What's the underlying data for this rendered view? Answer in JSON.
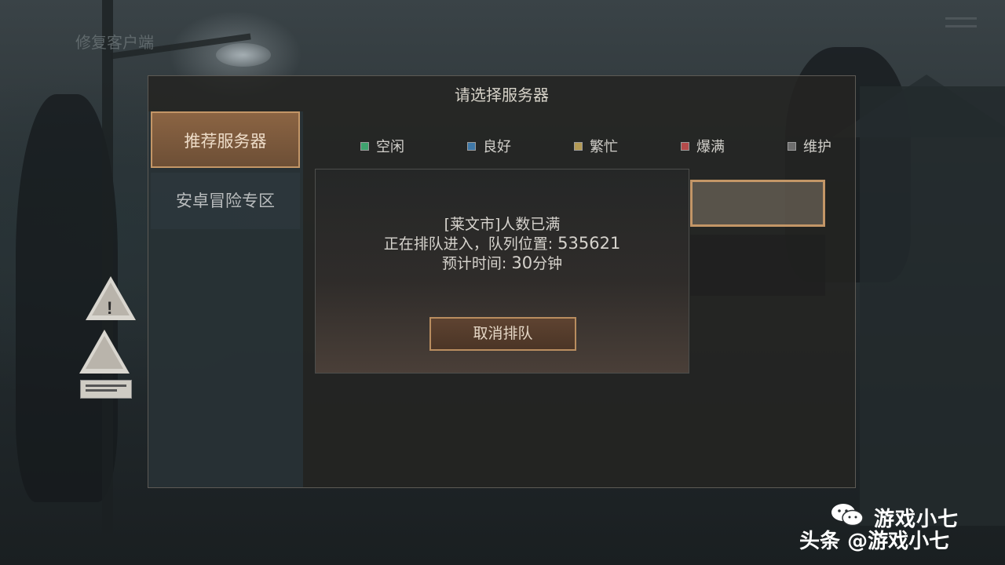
{
  "app": {
    "title": "修复客户端"
  },
  "dialog": {
    "title": "请选择服务器",
    "sidebar": [
      {
        "label": "推荐服务器",
        "active": true
      },
      {
        "label": "安卓冒险专区",
        "active": false
      }
    ],
    "legend": [
      {
        "label": "空闲",
        "color": "#3fa36f"
      },
      {
        "label": "良好",
        "color": "#3f78a8"
      },
      {
        "label": "繁忙",
        "color": "#b39a55"
      },
      {
        "label": "爆满",
        "color": "#b54b4b"
      },
      {
        "label": "维护",
        "color": "#6e6e6e"
      }
    ]
  },
  "queue": {
    "line1": "[莱文市]人数已满",
    "line2_prefix": "正在排队进入，队列位置: ",
    "position": "535621",
    "line3_prefix": "预计时间: ",
    "time_value": "30",
    "time_unit": "分钟",
    "cancel_label": "取消排队"
  },
  "watermark": {
    "platform": "头条",
    "account": "游戏小七",
    "handle": "@游戏小七"
  }
}
